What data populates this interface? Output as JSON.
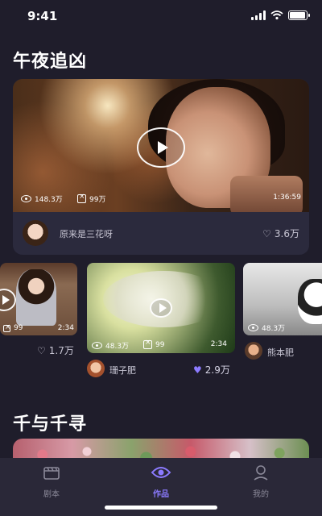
{
  "status_bar": {
    "time": "9:41",
    "icons": [
      "signal-icon",
      "wifi-icon",
      "battery-icon"
    ]
  },
  "sections": [
    {
      "title": "午夜追凶",
      "featured": {
        "views": "148.3万",
        "clips": "99万",
        "duration": "1:36:59",
        "author": "原来是三花呀",
        "likes": "3.6万"
      },
      "cards": [
        {
          "views": "99",
          "duration": "2:34",
          "likes": "1.7万",
          "liked": false
        },
        {
          "views": "48.3万",
          "clips": "99",
          "duration": "2:34",
          "author": "珊子肥",
          "likes": "2.9万",
          "liked": true
        },
        {
          "views": "48.3万",
          "author": "熊本肥"
        }
      ]
    },
    {
      "title": "千与千寻"
    }
  ],
  "tabs": [
    {
      "label": "剧本",
      "icon": "clapperboard-icon",
      "active": false
    },
    {
      "label": "作品",
      "icon": "eye-icon",
      "active": true
    },
    {
      "label": "我的",
      "icon": "user-icon",
      "active": false
    }
  ],
  "colors": {
    "background": "#1f1d2b",
    "card": "#2b2a3d",
    "accent": "#8c7bff",
    "tab_bar": "#2a2838"
  }
}
